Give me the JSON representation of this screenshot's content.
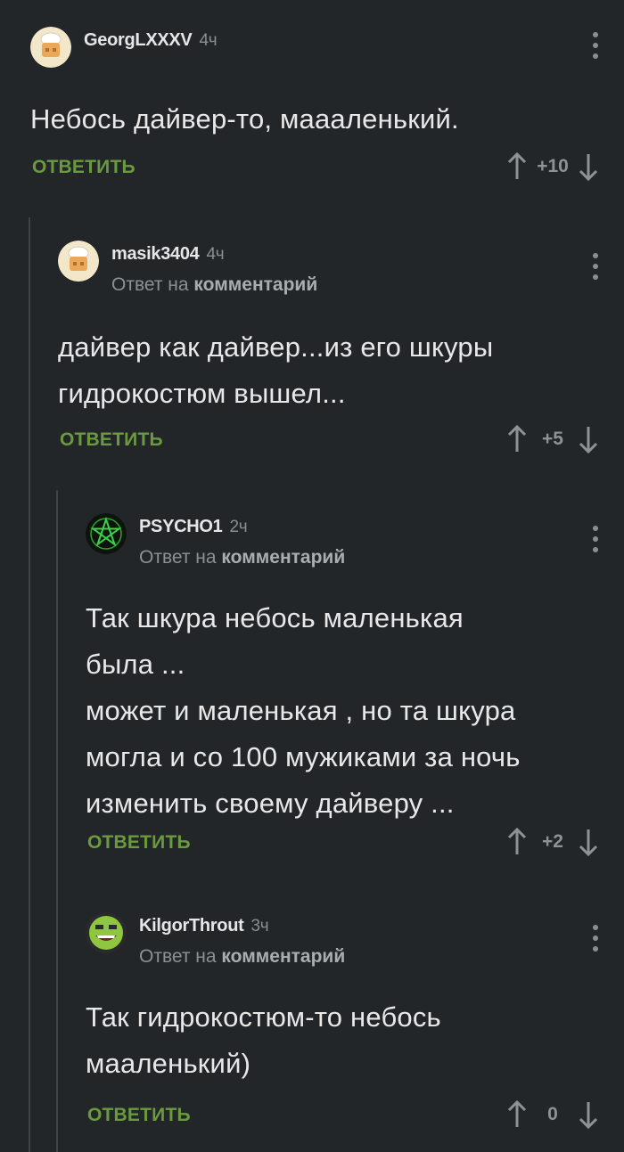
{
  "comments": [
    {
      "username": "GeorgLXXXV",
      "time": "4ч",
      "reply_prefix": "",
      "reply_target": "",
      "text": "Небось дайвер-то, маааленький.",
      "reply_label": "ОТВЕТИТЬ",
      "score": "+10",
      "avatar": "chef-avatar"
    },
    {
      "username": "masik3404",
      "time": "4ч",
      "reply_prefix": "Ответ на ",
      "reply_target": "комментарий",
      "text": "дайвер как дайвер...из его шкуры\nгидрокостюм вышел...",
      "reply_label": "ОТВЕТИТЬ",
      "score": "+5",
      "avatar": "chef-avatar"
    },
    {
      "username": "PSYCHO1",
      "time": "2ч",
      "reply_prefix": "Ответ на ",
      "reply_target": "комментарий",
      "text": "Так шкура небось маленькая\nбыла ...\nможет и маленькая , но та шкура\nмогла и со 100 мужиками за ночь\nизменить своему дайверу ...",
      "reply_label": "ОТВЕТИТЬ",
      "score": "+2",
      "avatar": "pentagram-avatar"
    },
    {
      "username": "KilgorThrout",
      "time": "3ч",
      "reply_prefix": "Ответ на ",
      "reply_target": "комментарий",
      "text": "Так гидрокостюм-то небось\nмааленький)",
      "reply_label": "ОТВЕТИТЬ",
      "score": "0",
      "avatar": "smiley-avatar"
    }
  ],
  "colors": {
    "background": "#232629",
    "reply_green": "#6a9a3e",
    "muted": "#8a8e92"
  }
}
